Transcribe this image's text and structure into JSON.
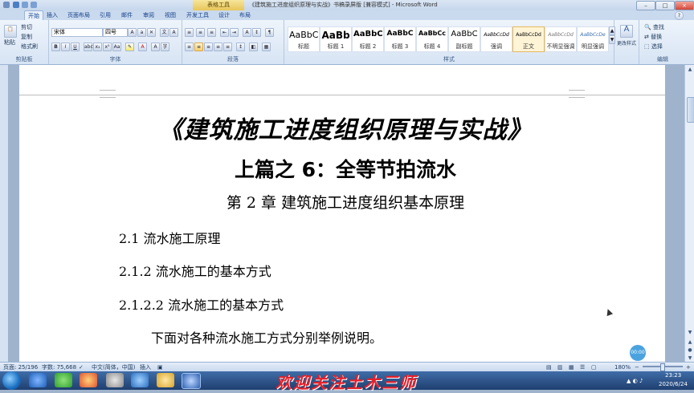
{
  "window": {
    "context_tab": "表格工具",
    "title": "《建筑施工进度组织原理与实战》书稿录屏版 [兼容模式] - Microsoft Word",
    "minimize": "–",
    "maximize": "□",
    "close": "×"
  },
  "ribbon_tabs": [
    "开始",
    "插入",
    "页面布局",
    "引用",
    "邮件",
    "审阅",
    "视图",
    "开发工具",
    "设计",
    "布局"
  ],
  "clipboard": {
    "paste": "粘贴",
    "cut": "剪切",
    "copy": "复制",
    "format_painter": "格式刷",
    "group_label": "剪贴板"
  },
  "font": {
    "name": "宋体",
    "size": "四号",
    "group_label": "字体"
  },
  "paragraph": {
    "group_label": "段落"
  },
  "styles": {
    "items": [
      {
        "sample": "AaBbC",
        "name": "标题"
      },
      {
        "sample": "AaBb",
        "name": "标题 1"
      },
      {
        "sample": "AaBbC",
        "name": "标题 2"
      },
      {
        "sample": "AaBbC",
        "name": "标题 3"
      },
      {
        "sample": "AaBbCc",
        "name": "标题 4"
      },
      {
        "sample": "AaBbC",
        "name": "副标题"
      },
      {
        "sample": "AaBbCcDd",
        "name": "强调"
      },
      {
        "sample": "AaBbCcDd",
        "name": "正文"
      },
      {
        "sample": "AaBbCcDd",
        "name": "不明显强调"
      },
      {
        "sample": "AaBbCcDe",
        "name": "明显强调"
      }
    ],
    "change_styles": "更改样式",
    "group_label": "样式"
  },
  "editing": {
    "find": "查找",
    "replace": "替换",
    "select": "选择",
    "group_label": "编辑"
  },
  "document": {
    "title": "《建筑施工进度组织原理与实战》",
    "subtitle": "上篇之 6：全等节拍流水",
    "chapter": "第 2 章  建筑施工进度组织基本原理",
    "h1": "2.1 流水施工原理",
    "h2": "2.1.2 流水施工的基本方式",
    "h3": "2.1.2.2 流水施工的基本方式",
    "paragraph": "下面对各种流水施工方式分别举例说明。"
  },
  "timer_badge": "00:00",
  "status": {
    "page": "页面: 25/196",
    "words": "字数: 75,668",
    "language": "中文(简体，中国)",
    "insert": "插入",
    "zoom": "180%"
  },
  "overlay_banner": "欢迎关注土木三师",
  "tray": {
    "time": "23:23",
    "date": "2020/6/24"
  },
  "colors": {
    "banner": "#e5202a",
    "ribbon": "#dbe6f4",
    "taskbar": "#1f3f6f"
  }
}
